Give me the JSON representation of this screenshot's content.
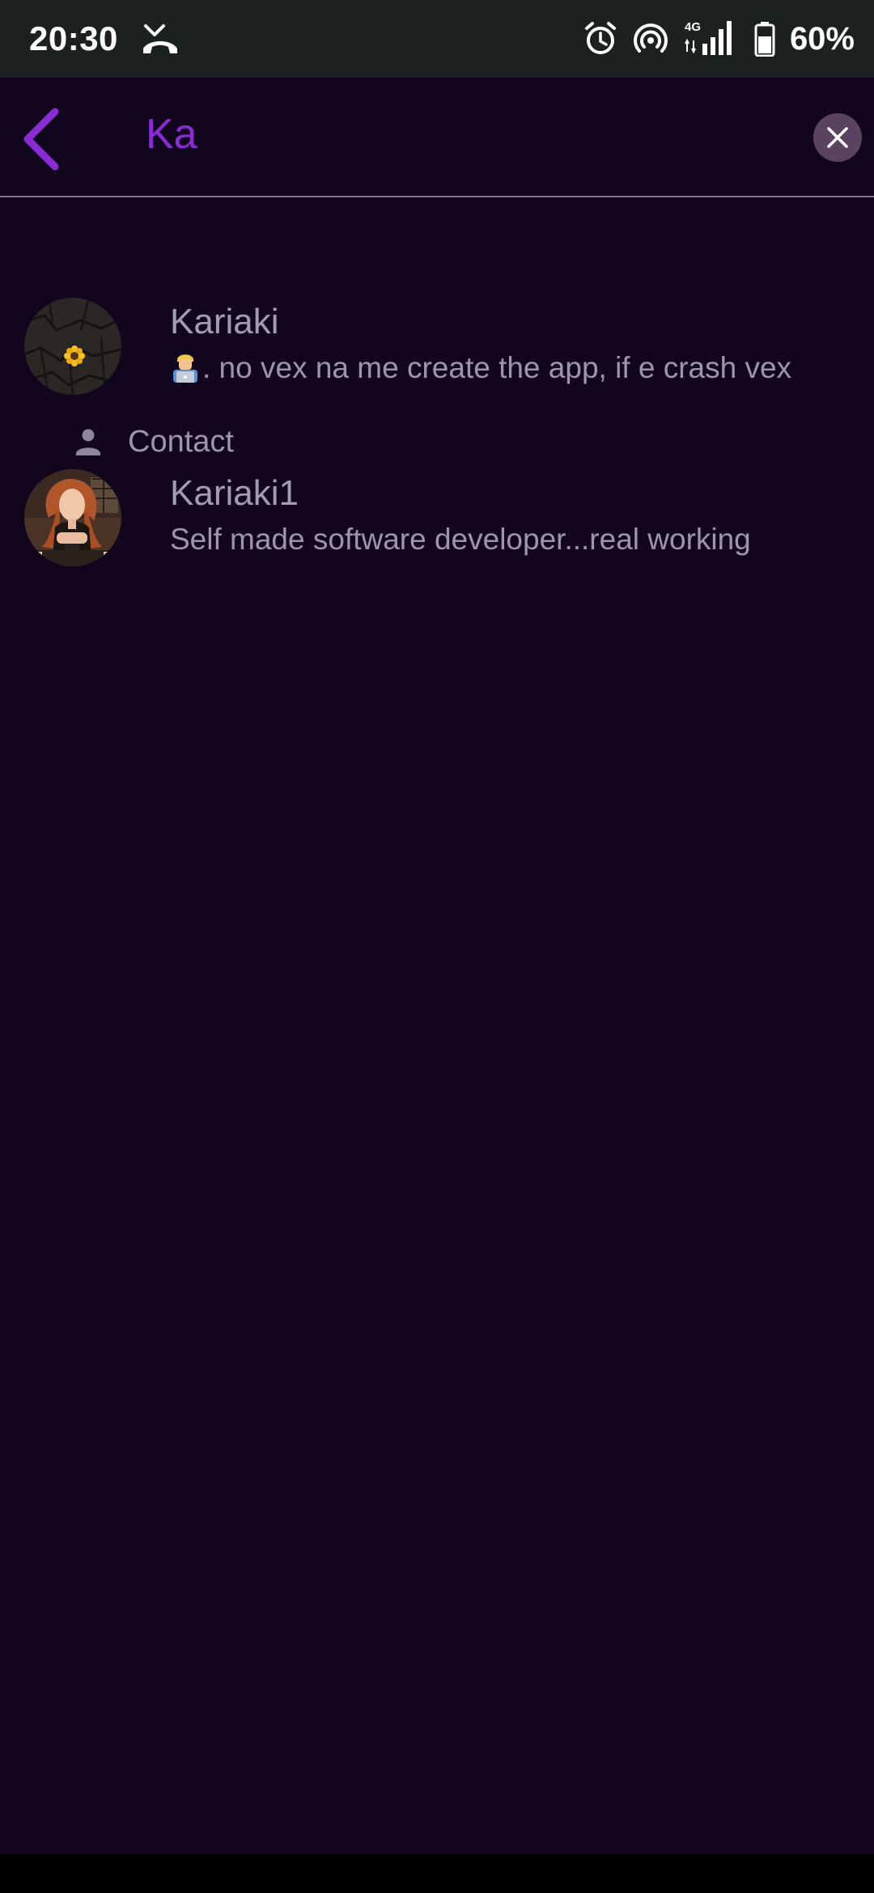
{
  "status_bar": {
    "time": "20:30",
    "battery_percent": "60%",
    "network_type": "4G",
    "icons": [
      "missed-call-icon",
      "alarm-icon",
      "hotspot-icon",
      "signal-icon",
      "battery-icon"
    ]
  },
  "search": {
    "query": "Ka",
    "back_icon": "chevron-left-icon",
    "clear_icon": "close-icon"
  },
  "results": [
    {
      "name": "Kariaki",
      "emoji": "technologist-icon",
      "description": ". no vex na me create the app, if e crash vex",
      "avatar": "sunflower-avatar"
    }
  ],
  "contacts_section": {
    "label": "Contact",
    "icon": "person-icon",
    "items": [
      {
        "name": "Kariaki1",
        "description": "Self made software developer...real working",
        "avatar": "portrait-avatar"
      }
    ]
  },
  "colors": {
    "background": "#12061f",
    "status_bar": "#1b2120",
    "accent": "#8a2bd6",
    "divider": "#7d7794",
    "clear_button": "#5a4360",
    "text_secondary": "#a39db0"
  }
}
